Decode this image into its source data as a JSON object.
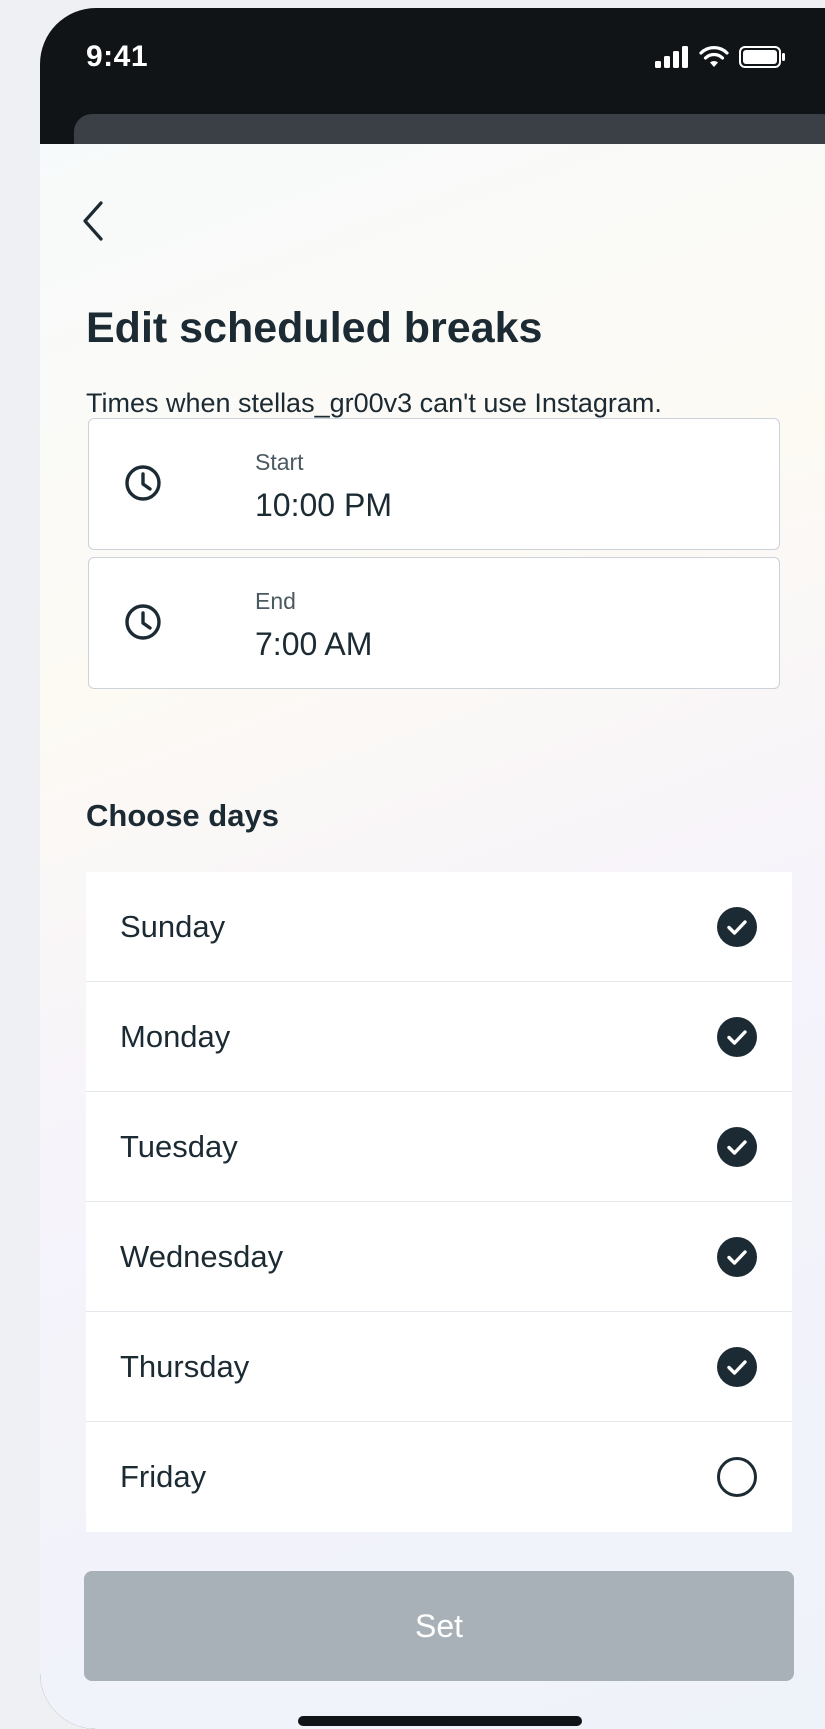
{
  "status_bar": {
    "time": "9:41"
  },
  "page": {
    "title": "Edit scheduled breaks",
    "subtitle": "Times when stellas_gr00v3 can't use Instagram."
  },
  "start": {
    "label": "Start",
    "value": "10:00 PM"
  },
  "end": {
    "label": "End",
    "value": "7:00 AM"
  },
  "days_section": {
    "title": "Choose days",
    "items": [
      {
        "label": "Sunday",
        "checked": true
      },
      {
        "label": "Monday",
        "checked": true
      },
      {
        "label": "Tuesday",
        "checked": true
      },
      {
        "label": "Wednesday",
        "checked": true
      },
      {
        "label": "Thursday",
        "checked": true
      },
      {
        "label": "Friday",
        "checked": false
      }
    ]
  },
  "set_button": {
    "label": "Set",
    "disabled": true
  },
  "icons": {
    "back": "chevron-left-icon",
    "clock": "clock-icon",
    "checked": "checkmark-circle-filled-icon",
    "unchecked": "empty-circle-icon"
  },
  "colors": {
    "text": "#1c2b33",
    "check_fill": "#1c2b33",
    "disabled_button": "#a8b1b8"
  }
}
